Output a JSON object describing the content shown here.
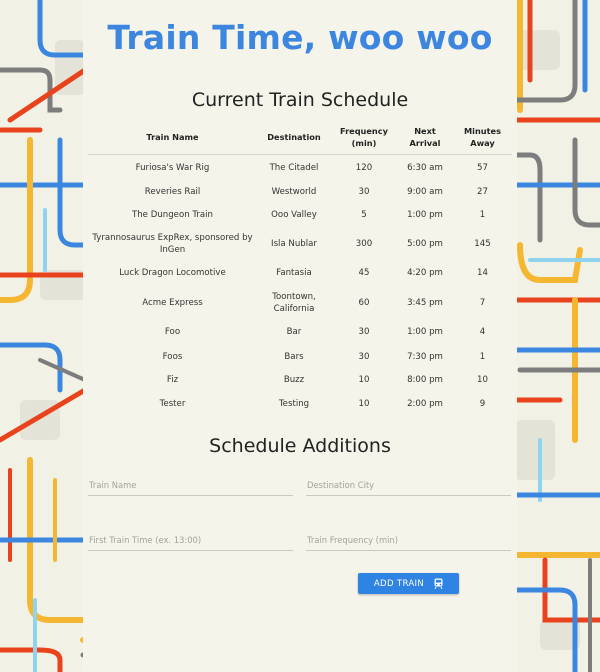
{
  "header": {
    "title": "Train Time, woo woo"
  },
  "schedule": {
    "heading": "Current Train Schedule",
    "columns": [
      "Train Name",
      "Destination",
      "Frequency (min)",
      "Next Arrival",
      "Minutes Away"
    ],
    "rows": [
      [
        "Furiosa's War Rig",
        "The Citadel",
        "120",
        "6:30 am",
        "57"
      ],
      [
        "Reveries Rail",
        "Westworld",
        "30",
        "9:00 am",
        "27"
      ],
      [
        "The Dungeon Train",
        "Ooo Valley",
        "5",
        "1:00 pm",
        "1"
      ],
      [
        "Tyrannosaurus ExpRex, sponsored by InGen",
        "Isla Nublar",
        "300",
        "5:00 pm",
        "145"
      ],
      [
        "Luck Dragon Locomotive",
        "Fantasia",
        "45",
        "4:20 pm",
        "14"
      ],
      [
        "Acme Express",
        "Toontown, California",
        "60",
        "3:45 pm",
        "7"
      ],
      [
        "Foo",
        "Bar",
        "30",
        "1:00 pm",
        "4"
      ],
      [
        "Foos",
        "Bars",
        "30",
        "7:30 pm",
        "1"
      ],
      [
        "Fiz",
        "Buzz",
        "10",
        "8:00 pm",
        "10"
      ],
      [
        "Tester",
        "Testing",
        "10",
        "2:00 pm",
        "9"
      ]
    ]
  },
  "form": {
    "heading": "Schedule Additions",
    "train_name_placeholder": "Train Name",
    "destination_placeholder": "Destination City",
    "first_time_placeholder": "First Train Time (ex. 13:00)",
    "frequency_placeholder": "Train Frequency (min)",
    "submit_label": "ADD TRAIN",
    "submit_icon": "train-icon"
  },
  "colors": {
    "title": "#3d86e0",
    "button": "#2f83e3",
    "line_yellow": "#f5b731",
    "line_red": "#e8431d",
    "line_blue": "#3b87e0",
    "line_lightblue": "#8fd3ef",
    "line_gray": "#7d7d7d",
    "background": "#f1f1e6"
  }
}
